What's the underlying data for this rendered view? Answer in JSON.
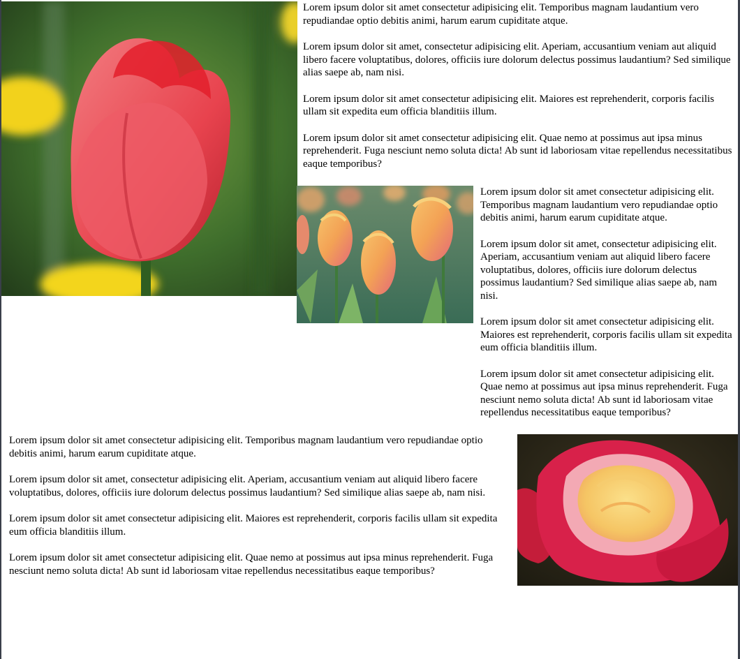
{
  "images": {
    "red_tulip": {
      "subject": "red tulip close-up",
      "colors": {
        "petal": "#e8434e",
        "petal_light": "#f27c80",
        "background": "#3f6e2c",
        "accent": "#f2d21a"
      }
    },
    "tulip_field": {
      "subject": "orange and pink tulips field",
      "colors": {
        "petal": "#f3a255",
        "petal_pink": "#e46a78",
        "leaves": "#4e8a6c"
      }
    },
    "rose": {
      "subject": "red and yellow rose",
      "colors": {
        "petal": "#d8214a",
        "center": "#f9d776",
        "background": "#2c2718"
      }
    }
  },
  "sections": [
    {
      "paragraphs": [
        "Lorem ipsum dolor sit amet consectetur adipisicing elit. Temporibus magnam laudantium vero repudiandae optio debitis animi, harum earum cupiditate atque.",
        "Lorem ipsum dolor sit amet, consectetur adipisicing elit. Aperiam, accusantium veniam aut aliquid libero facere voluptatibus, dolores, officiis iure dolorum delectus possimus laudantium? Sed similique alias saepe ab, nam nisi.",
        "Lorem ipsum dolor sit amet consectetur adipisicing elit. Maiores est reprehenderit, corporis facilis ullam sit expedita eum officia blanditiis illum.",
        "Lorem ipsum dolor sit amet consectetur adipisicing elit. Quae nemo at possimus aut ipsa minus reprehenderit. Fuga nesciunt nemo soluta dicta! Ab sunt id laboriosam vitae repellendus necessitatibus eaque temporibus?"
      ]
    },
    {
      "paragraphs": [
        "Lorem ipsum dolor sit amet consectetur adipisicing elit. Temporibus magnam laudantium vero repudiandae optio debitis animi, harum earum cupiditate atque.",
        "Lorem ipsum dolor sit amet, consectetur adipisicing elit. Aperiam, accusantium veniam aut aliquid libero facere voluptatibus, dolores, officiis iure dolorum delectus possimus laudantium? Sed similique alias saepe ab, nam nisi.",
        "Lorem ipsum dolor sit amet consectetur adipisicing elit. Maiores est reprehenderit, corporis facilis ullam sit expedita eum officia blanditiis illum.",
        "Lorem ipsum dolor sit amet consectetur adipisicing elit. Quae nemo at possimus aut ipsa minus reprehenderit. Fuga nesciunt nemo soluta dicta! Ab sunt id laboriosam vitae repellendus necessitatibus eaque temporibus?"
      ]
    },
    {
      "paragraphs": [
        "Lorem ipsum dolor sit amet consectetur adipisicing elit. Temporibus magnam laudantium vero repudiandae optio debitis animi, harum earum cupiditate atque.",
        "Lorem ipsum dolor sit amet, consectetur adipisicing elit. Aperiam, accusantium veniam aut aliquid libero facere voluptatibus, dolores, officiis iure dolorum delectus possimus laudantium? Sed similique alias saepe ab, nam nisi.",
        "Lorem ipsum dolor sit amet consectetur adipisicing elit. Maiores est reprehenderit, corporis facilis ullam sit expedita eum officia blanditiis illum.",
        "Lorem ipsum dolor sit amet consectetur adipisicing elit. Quae nemo at possimus aut ipsa minus reprehenderit. Fuga nesciunt nemo soluta dicta! Ab sunt id laboriosam vitae repellendus necessitatibus eaque temporibus?"
      ]
    }
  ]
}
